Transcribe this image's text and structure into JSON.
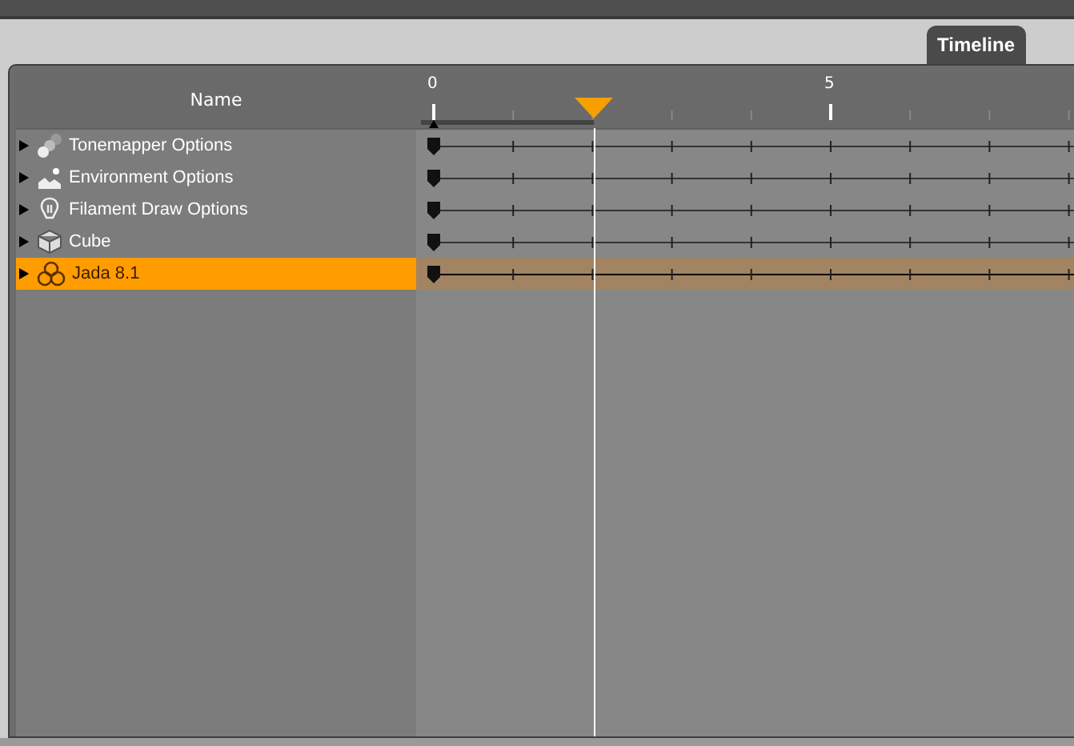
{
  "tab": {
    "label": "Timeline",
    "selected": true
  },
  "columns": {
    "name": "Name"
  },
  "ruler": {
    "labels": [
      "0",
      "5"
    ],
    "playhead": {
      "level": 0.25
    }
  },
  "rows": [
    {
      "label": "Tonemapper Options",
      "kind": "tonemapper",
      "expanded": false,
      "selected": false
    },
    {
      "label": "Environment Options",
      "kind": "environment",
      "expanded": false,
      "selected": false
    },
    {
      "label": "Filament Draw Options",
      "kind": "filament",
      "expanded": false,
      "selected": false
    },
    {
      "label": "Cube",
      "kind": "cube",
      "expanded": false,
      "selected": false
    },
    {
      "label": "Jada 8.1",
      "kind": "figure",
      "expanded": false,
      "selected": true
    }
  ]
}
